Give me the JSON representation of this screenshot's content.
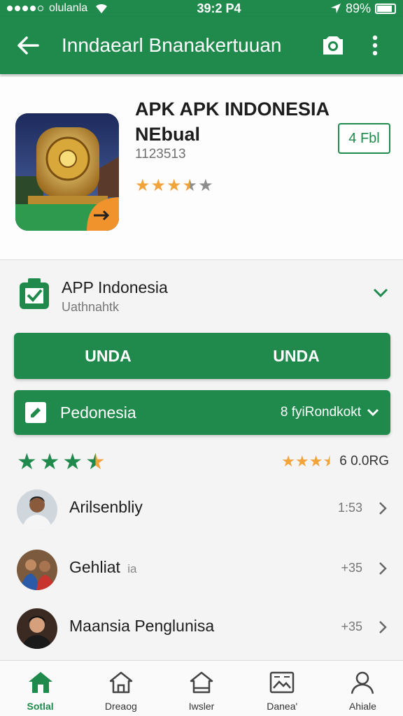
{
  "status_bar": {
    "carrier": "olulanla",
    "time": "39:2 P4",
    "battery_text": "89%",
    "battery_level": 0.89,
    "signal_dots_filled": 4
  },
  "app_bar": {
    "title": "Inndaearl Bnanakertuuan",
    "back_icon": "arrow-left-icon",
    "camera_icon": "camera-icon",
    "menu_icon": "more-vert-icon"
  },
  "hero": {
    "title": "APK APK INDONESIA NEbual",
    "subtitle": "1123513",
    "rating": 3.5,
    "action_label": "4 Fbl"
  },
  "app_row": {
    "title": "APP Indonesia",
    "subtitle": "Uathnahtk"
  },
  "buttons": {
    "left": "UNDA",
    "right": "UNDA"
  },
  "select_bar": {
    "label": "Pedonesia",
    "value": "8 fyiRondkokt"
  },
  "ratings": {
    "big_stars": 3.5,
    "small_stars": 3.5,
    "small_value": "6 0.0RG"
  },
  "list": [
    {
      "name": "Arilsenbliy",
      "time": "1:53"
    },
    {
      "name": "Gehliat",
      "tag": "ia",
      "time": "+35"
    },
    {
      "name": "Maansia Penglunisa",
      "time": "+35"
    }
  ],
  "bottom_nav": [
    {
      "label": "Sotlal",
      "icon": "home-icon",
      "active": true
    },
    {
      "label": "Dreaog",
      "icon": "home-outline-icon",
      "active": false
    },
    {
      "label": "Iwsler",
      "icon": "house-icon",
      "active": false
    },
    {
      "label": "Danea'",
      "icon": "image-icon",
      "active": false
    },
    {
      "label": "Ahiale",
      "icon": "person-icon",
      "active": false
    }
  ],
  "colors": {
    "primary": "#1f8a4c",
    "accent_star": "#f2a33a",
    "gray_star": "#8d8d8d"
  }
}
